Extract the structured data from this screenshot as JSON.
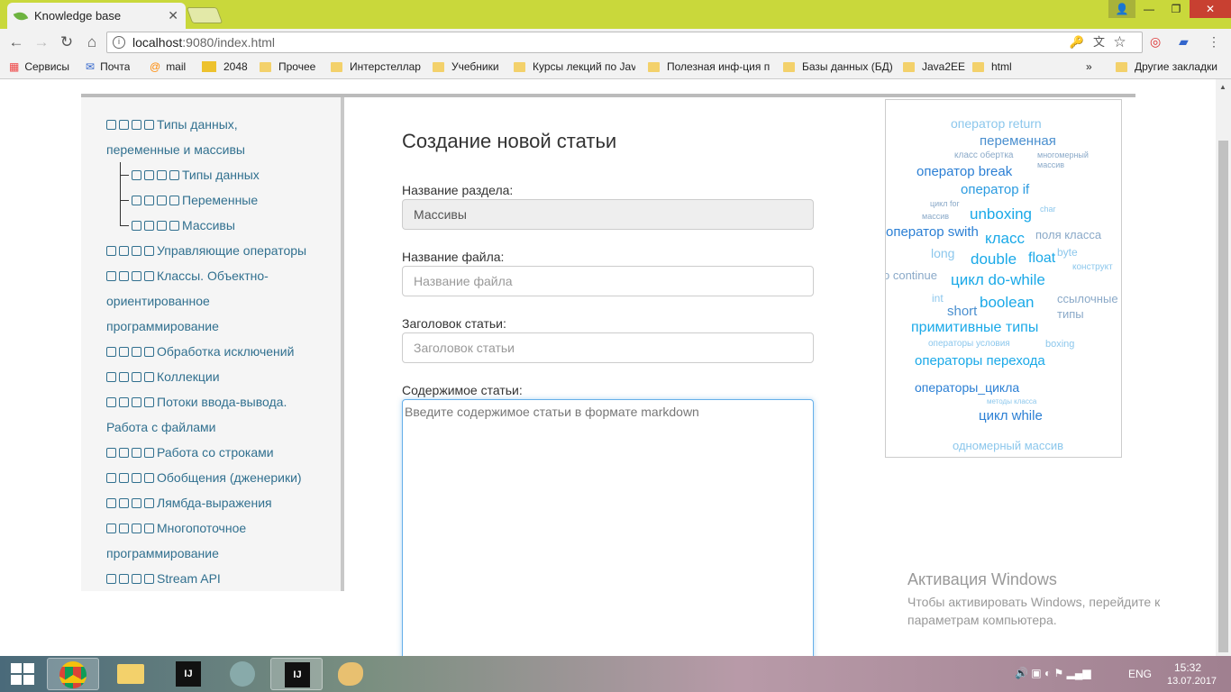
{
  "browser": {
    "tab_title": "Knowledge base",
    "url_host": "localhost",
    "url_port": ":9080",
    "url_path": "/index.html"
  },
  "bookmarks": [
    "Сервисы",
    "Почта",
    "mail",
    "2048",
    "Прочее",
    "Интерстеллар",
    "Учебники",
    "Курсы лекций по Jav",
    "Полезная инф-ция п",
    "Базы данных (БД)",
    "Java2EE",
    "html",
    "»",
    "Другие закладки"
  ],
  "sidebar": {
    "items": [
      {
        "label": "Типы данных,",
        "cont": "переменные и массивы"
      },
      {
        "label": "Типы данных"
      },
      {
        "label": "Переменные"
      },
      {
        "label": "Массивы"
      },
      {
        "label": "Управляющие операторы"
      },
      {
        "label": "Классы. Объектно-",
        "cont": "ориентированное",
        "cont2": "программирование"
      },
      {
        "label": "Обработка исключений"
      },
      {
        "label": "Коллекции"
      },
      {
        "label": "Потоки ввода-вывода.",
        "cont": "Работа с файлами"
      },
      {
        "label": "Работа со строками"
      },
      {
        "label": "Обобщения (дженерики)"
      },
      {
        "label": "Лямбда-выражения"
      },
      {
        "label": "Многопоточное",
        "cont": "программирование"
      },
      {
        "label": "Stream API"
      }
    ]
  },
  "form": {
    "title": "Создание новой статьи",
    "section_label": "Название раздела:",
    "section_value": "Массивы",
    "file_label": "Название файла:",
    "file_placeholder": "Название файла",
    "header_label": "Заголовок статьи:",
    "header_placeholder": "Заголовок статьи",
    "content_label": "Содержимое статьи:",
    "content_placeholder": "Введите содержимое статьи в формате markdown"
  },
  "tag_cloud": [
    "оператор return",
    "переменная",
    "класс обертка",
    "многомерный",
    "массив",
    "оператор break",
    "оператор if",
    "цикл for",
    "массив",
    "unboxing",
    "char",
    "оператор swith",
    "класс",
    "поля класса",
    "long",
    "double",
    "float",
    "byte",
    "конструкт",
    "o continue",
    "цикл do-while",
    "int",
    "boolean",
    "ссылочные",
    "типы",
    "short",
    "примитивные типы",
    "операторы условия",
    "boxing",
    "операторы перехода",
    "операторы_цикла",
    "методы класса",
    "цикл while",
    "одномерный массив"
  ],
  "watermark": {
    "title": "Активация Windows",
    "line1": "Чтобы активировать Windows, перейдите к",
    "line2": "параметрам компьютера."
  },
  "tray": {
    "lang": "ENG",
    "time": "15:32",
    "date": "13.07.2017"
  },
  "colors": {
    "accent": "#31708f",
    "chrome": "#c9d83b",
    "focus": "#66afe9"
  }
}
